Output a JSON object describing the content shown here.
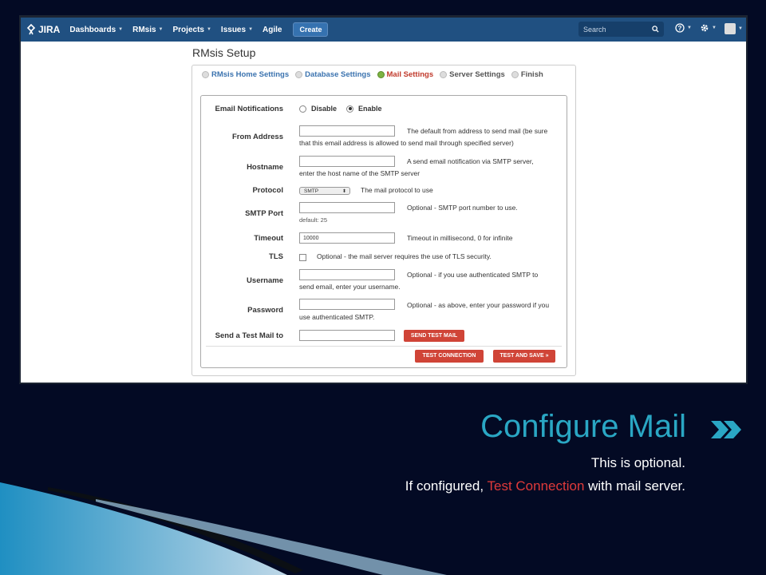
{
  "navbar": {
    "logo": "JIRA",
    "items": [
      "Dashboards",
      "RMsis",
      "Projects",
      "Issues",
      "Agile"
    ],
    "create": "Create",
    "search_placeholder": "Search"
  },
  "page": {
    "title": "RMsis Setup",
    "steps": [
      "RMsis Home Settings",
      "Database Settings",
      "Mail Settings",
      "Server Settings",
      "Finish"
    ],
    "current_step": "Mail Settings"
  },
  "form": {
    "email_notifications": {
      "label": "Email Notifications",
      "options": [
        "Disable",
        "Enable"
      ],
      "selected": "Enable"
    },
    "from_address": {
      "label": "From Address",
      "value": "",
      "help1": "The default from address to send mail (be sure",
      "help2": "that this email address is allowed to send mail through specified server)"
    },
    "hostname": {
      "label": "Hostname",
      "value": "",
      "help1": "A send email notification via SMTP server,",
      "help2": "enter the host name of the SMTP server"
    },
    "protocol": {
      "label": "Protocol",
      "value": "SMTP",
      "help": "The mail protocol to use"
    },
    "smtp_port": {
      "label": "SMTP Port",
      "value": "",
      "help": "Optional - SMTP port number to use.",
      "default": "default: 25"
    },
    "timeout": {
      "label": "Timeout",
      "value": "10000",
      "help": "Timeout in millisecond, 0 for infinite"
    },
    "tls": {
      "label": "TLS",
      "checked": false,
      "help": "Optional - the mail server requires the use of TLS security."
    },
    "username": {
      "label": "Username",
      "value": "",
      "help1": "Optional - if you use authenticated SMTP to",
      "help2": "send email, enter your username."
    },
    "password": {
      "label": "Password",
      "value": "",
      "help1": "Optional - as above, enter your password if you",
      "help2": "use authenticated SMTP."
    },
    "test_mail": {
      "label": "Send a Test Mail to",
      "value": "",
      "button": "SEND TEST MAIL"
    },
    "test_connection_button": "TEST CONNECTION",
    "test_and_save_button": "TEST AND SAVE »"
  },
  "slide": {
    "title": "Configure Mail",
    "line1": "This is optional.",
    "line2_prefix": "If configured, ",
    "line2_highlight": "Test Connection",
    "line2_suffix": " with mail server."
  },
  "colors": {
    "accent": "#2aa7c4",
    "highlight": "#e03a3a",
    "navbar": "#205081",
    "button": "#d04437",
    "background": "#030a24"
  }
}
